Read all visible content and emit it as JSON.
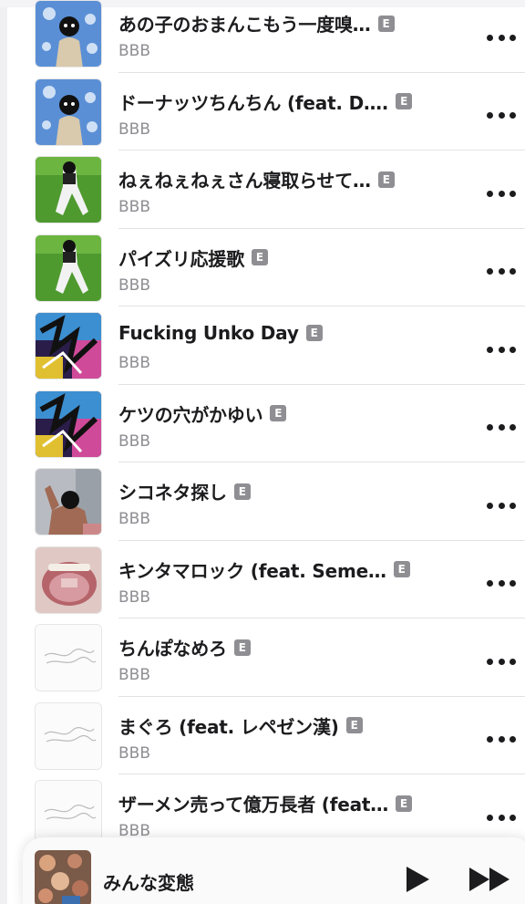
{
  "songs": [
    {
      "title": "あの子のおまんこもう一度嗅…",
      "artist": "BBB",
      "explicit": "E",
      "artwork": "masked-man-blue-art"
    },
    {
      "title": "ドーナッツちんちん (feat. D….",
      "artist": "BBB",
      "explicit": "E",
      "artwork": "masked-man-blue-art"
    },
    {
      "title": "ねぇねぇねぇさん寝取らせて…",
      "artist": "BBB",
      "explicit": "E",
      "artwork": "grass-man-art"
    },
    {
      "title": "パイズリ応援歌",
      "artist": "BBB",
      "explicit": "E",
      "artwork": "grass-man-art"
    },
    {
      "title": "Fucking Unko Day",
      "artist": "BBB",
      "explicit": "E",
      "artwork": "graffiti-art"
    },
    {
      "title": "ケツの穴がかゆい",
      "artist": "BBB",
      "explicit": "E",
      "artwork": "graffiti-art"
    },
    {
      "title": "シコネタ探し",
      "artist": "BBB",
      "explicit": "E",
      "artwork": "masked-man-pose-art"
    },
    {
      "title": "キンタマロック (feat. Seme…",
      "artist": "BBB",
      "explicit": "E",
      "artwork": "mouth-art"
    },
    {
      "title": "ちんぽなめろ",
      "artist": "BBB",
      "explicit": "E",
      "artwork": "sketch-logo-art"
    },
    {
      "title": "まぐろ (feat. レペゼン漢)",
      "artist": "BBB",
      "explicit": "E",
      "artwork": "sketch-logo-art"
    },
    {
      "title": "ザーメン売って億万長者 (feat…",
      "artist": "BBB",
      "explicit": "E",
      "artwork": "sketch-logo-art"
    }
  ],
  "now_playing": {
    "title": "みんな変態",
    "play_icon": "play-icon",
    "next_icon": "forward-icon"
  },
  "colors": {
    "text": "#1c1c1e",
    "secondary": "#8e8e93",
    "divider": "#e3e3e6"
  }
}
